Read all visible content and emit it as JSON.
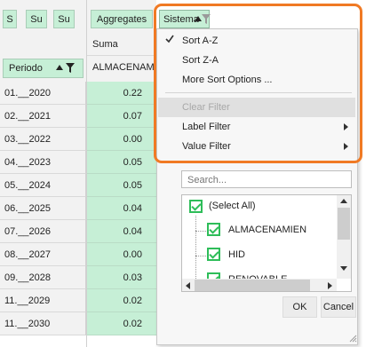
{
  "field_buttons": [
    "S",
    "Su",
    "Su"
  ],
  "aggregates_label": "Aggregates",
  "sistema_label": "Sistema",
  "column_header": {
    "suma": "Suma",
    "almacenam": "ALMACENAM"
  },
  "periodo_label": "Periodo",
  "rows": [
    {
      "label": "01.__2020",
      "value": "0.22"
    },
    {
      "label": "02.__2021",
      "value": "0.07"
    },
    {
      "label": "03.__2022",
      "value": "0.00"
    },
    {
      "label": "04.__2023",
      "value": "0.05"
    },
    {
      "label": "05.__2024",
      "value": "0.05"
    },
    {
      "label": "06.__2025",
      "value": "0.04"
    },
    {
      "label": "07.__2026",
      "value": "0.04"
    },
    {
      "label": "08.__2027",
      "value": "0.00"
    },
    {
      "label": "09.__2028",
      "value": "0.03"
    },
    {
      "label": "11.__2029",
      "value": "0.02"
    },
    {
      "label": "11.__2030",
      "value": "0.02"
    }
  ],
  "menu": {
    "sort_az": "Sort A-Z",
    "sort_za": "Sort Z-A",
    "more_sort": "More Sort Options ...",
    "clear_filter": "Clear Filter",
    "label_filter": "Label Filter",
    "value_filter": "Value Filter",
    "search_placeholder": "Search...",
    "list": [
      "(Select All)",
      "ALMACENAMIEN",
      "HID",
      "RENOVABLE"
    ],
    "ok": "OK",
    "cancel": "Cancel"
  },
  "highlight_color": "#f07a24",
  "accent_green": "#2ebd59"
}
